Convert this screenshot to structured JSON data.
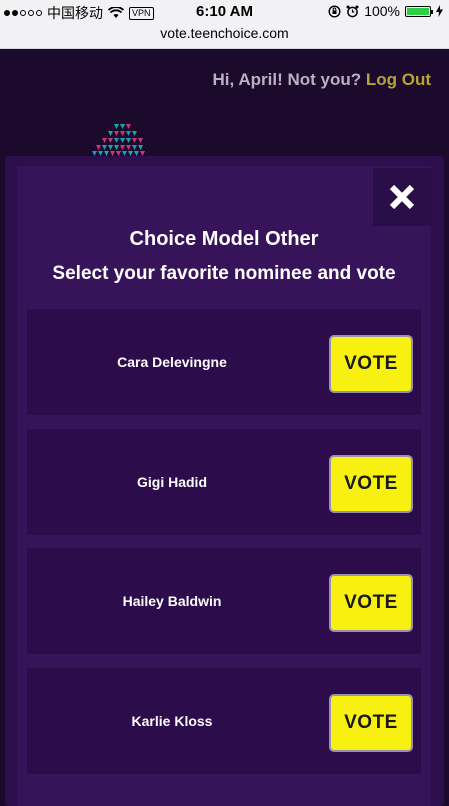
{
  "status_bar": {
    "carrier": "中国移动",
    "vpn": "VPN",
    "time": "6:10 AM",
    "battery_percent": "100%",
    "battery_level": 1.0
  },
  "browser": {
    "url": "vote.teenchoice.com"
  },
  "header": {
    "greeting": "Hi, April! Not you?",
    "logout": "Log Out"
  },
  "modal": {
    "close_icon": "close-icon",
    "title": "Choice Model Other",
    "subtitle": "Select your favorite nominee and vote",
    "nominees": [
      {
        "name": "Cara Delevingne",
        "vote_label": "VOTE"
      },
      {
        "name": "Gigi Hadid",
        "vote_label": "VOTE"
      },
      {
        "name": "Hailey Baldwin",
        "vote_label": "VOTE"
      },
      {
        "name": "Karlie Kloss",
        "vote_label": "VOTE"
      }
    ]
  },
  "colors": {
    "background": "#1b0a2c",
    "modal": "#37145a",
    "vote_button": "#f8f011",
    "logout_link": "#b8a23a"
  }
}
